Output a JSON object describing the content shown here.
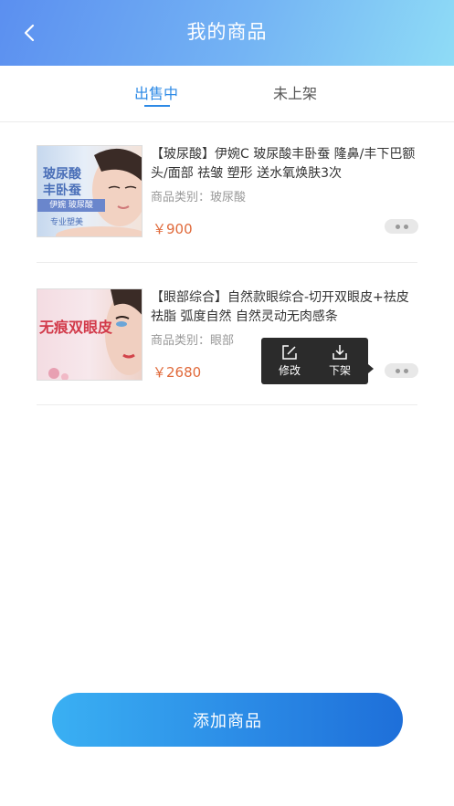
{
  "header": {
    "title": "我的商品"
  },
  "tabs": [
    {
      "label": "出售中"
    },
    {
      "label": "未上架"
    }
  ],
  "products": [
    {
      "title": "【玻尿酸】伊婉C 玻尿酸丰卧蚕 隆鼻/丰下巴额头/面部 祛皱 塑形 送水氧焕肤3次",
      "category": "商品类别：玻尿酸",
      "price": "￥900",
      "thumb_text_1": "玻尿酸",
      "thumb_text_2": "丰卧蚕",
      "thumb_brand": "伊婉 玻尿酸",
      "thumb_tag": "专业塑美"
    },
    {
      "title": "【眼部综合】自然款眼综合-切开双眼皮+祛皮祛脂 弧度自然 自然灵动无肉感条",
      "category": "商品类别：眼部",
      "price": "￥2680",
      "thumb_text": "无痕双眼皮"
    }
  ],
  "popup": {
    "edit_label": "修改",
    "unlist_label": "下架"
  },
  "footer": {
    "add_label": "添加商品"
  },
  "colors": {
    "accent": "#2d8ae6",
    "price": "#e06a3b"
  }
}
